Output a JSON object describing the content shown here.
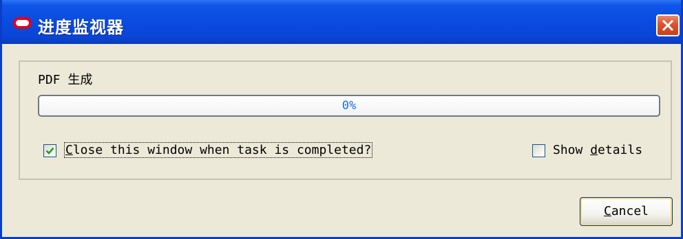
{
  "window": {
    "title": "进度监视器",
    "icon": "oracle-logo-icon",
    "close_icon": "close-icon",
    "accent_color": "#0a4be0"
  },
  "task": {
    "label": "PDF 生成",
    "progress_text": "0%",
    "progress_value": 0
  },
  "options": {
    "close_when_done": {
      "label_first": "C",
      "label_rest": "lose this window when task is completed?",
      "checked": true
    },
    "show_details": {
      "label_pre": "Show ",
      "label_underlined": "d",
      "label_rest": "etails",
      "checked": false
    }
  },
  "buttons": {
    "cancel_first": "C",
    "cancel_rest": "ancel"
  }
}
